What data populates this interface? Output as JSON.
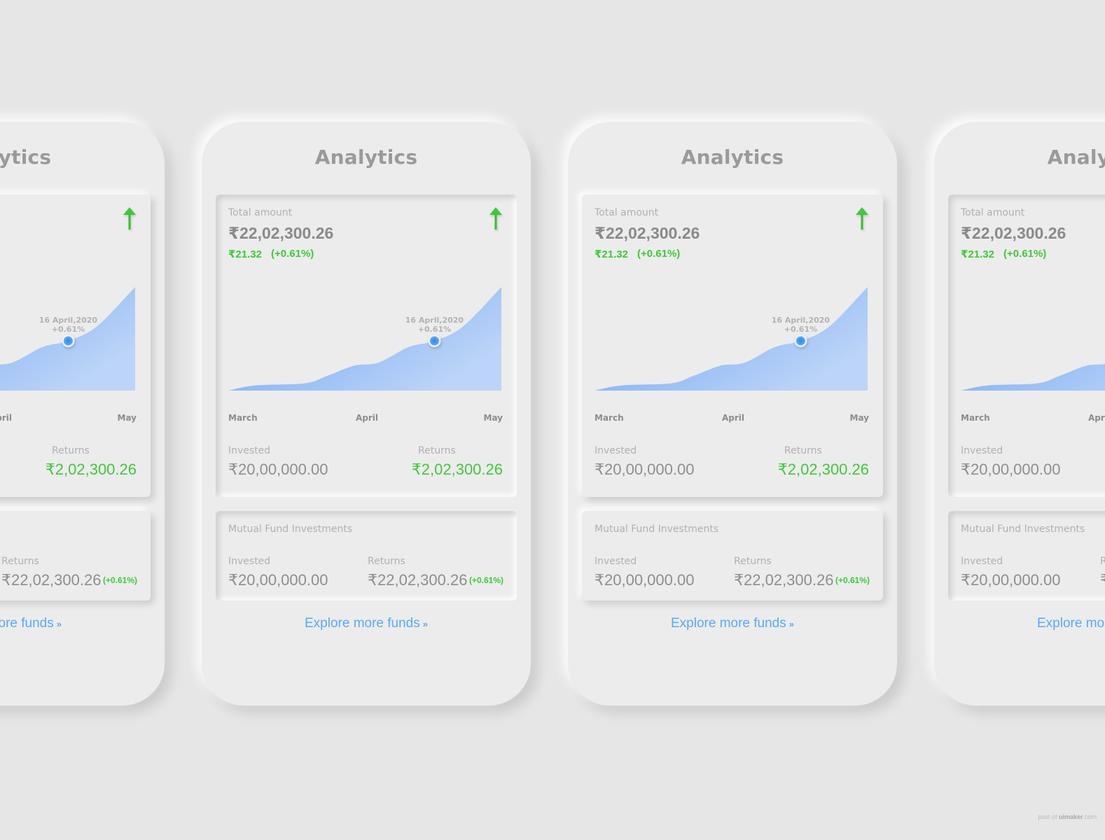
{
  "colors": {
    "background": "#e6e6e6",
    "surface": "#ececec",
    "positive": "#3ec93a",
    "link": "#5aa9f5",
    "chart_fill_top": "#6aa2f5",
    "chart_fill_bottom": "#bcd4f7"
  },
  "screen": {
    "title": "Analytics",
    "total": {
      "label": "Total amount",
      "amount": "₹22,02,300.26",
      "change_amount": "₹21.32",
      "change_percent": "(+0.61%)",
      "trend_icon": "arrow-up-icon"
    },
    "tooltip": {
      "date": "16 April,2020",
      "change": "+0.61%"
    },
    "summary": {
      "invested_label": "Invested",
      "invested_value": "₹20,00,000.00",
      "returns_label": "Returns",
      "returns_value": "₹2,02,300.26"
    },
    "mutual_funds": {
      "title": "Mutual Fund Investments",
      "invested_label": "Invested",
      "invested_value": "₹20,00,000.00",
      "returns_label": "Returns",
      "returns_value": "₹22,02,300.26",
      "returns_change": "(+0.61%)"
    },
    "explore_label": "Explore more funds",
    "explore_icon": "»"
  },
  "chart_data": {
    "type": "area",
    "title": "",
    "xlabel": "",
    "ylabel": "",
    "x_ticks": [
      "March",
      "April",
      "May"
    ],
    "x_range": [
      0,
      1
    ],
    "ylim": [
      0,
      100
    ],
    "x": [
      0,
      0.1,
      0.28,
      0.36,
      0.46,
      0.55,
      0.66,
      0.755,
      0.86,
      1.0
    ],
    "values": [
      0,
      5,
      7,
      14,
      24,
      27,
      42,
      48,
      62,
      100
    ],
    "highlight": {
      "x": 0.755,
      "value": 48,
      "label": "16 April,2020",
      "sublabel": "+0.61%"
    },
    "grid": false
  },
  "watermark": {
    "prefix": "post of ",
    "brand": "uimaker",
    "suffix": ".com"
  }
}
